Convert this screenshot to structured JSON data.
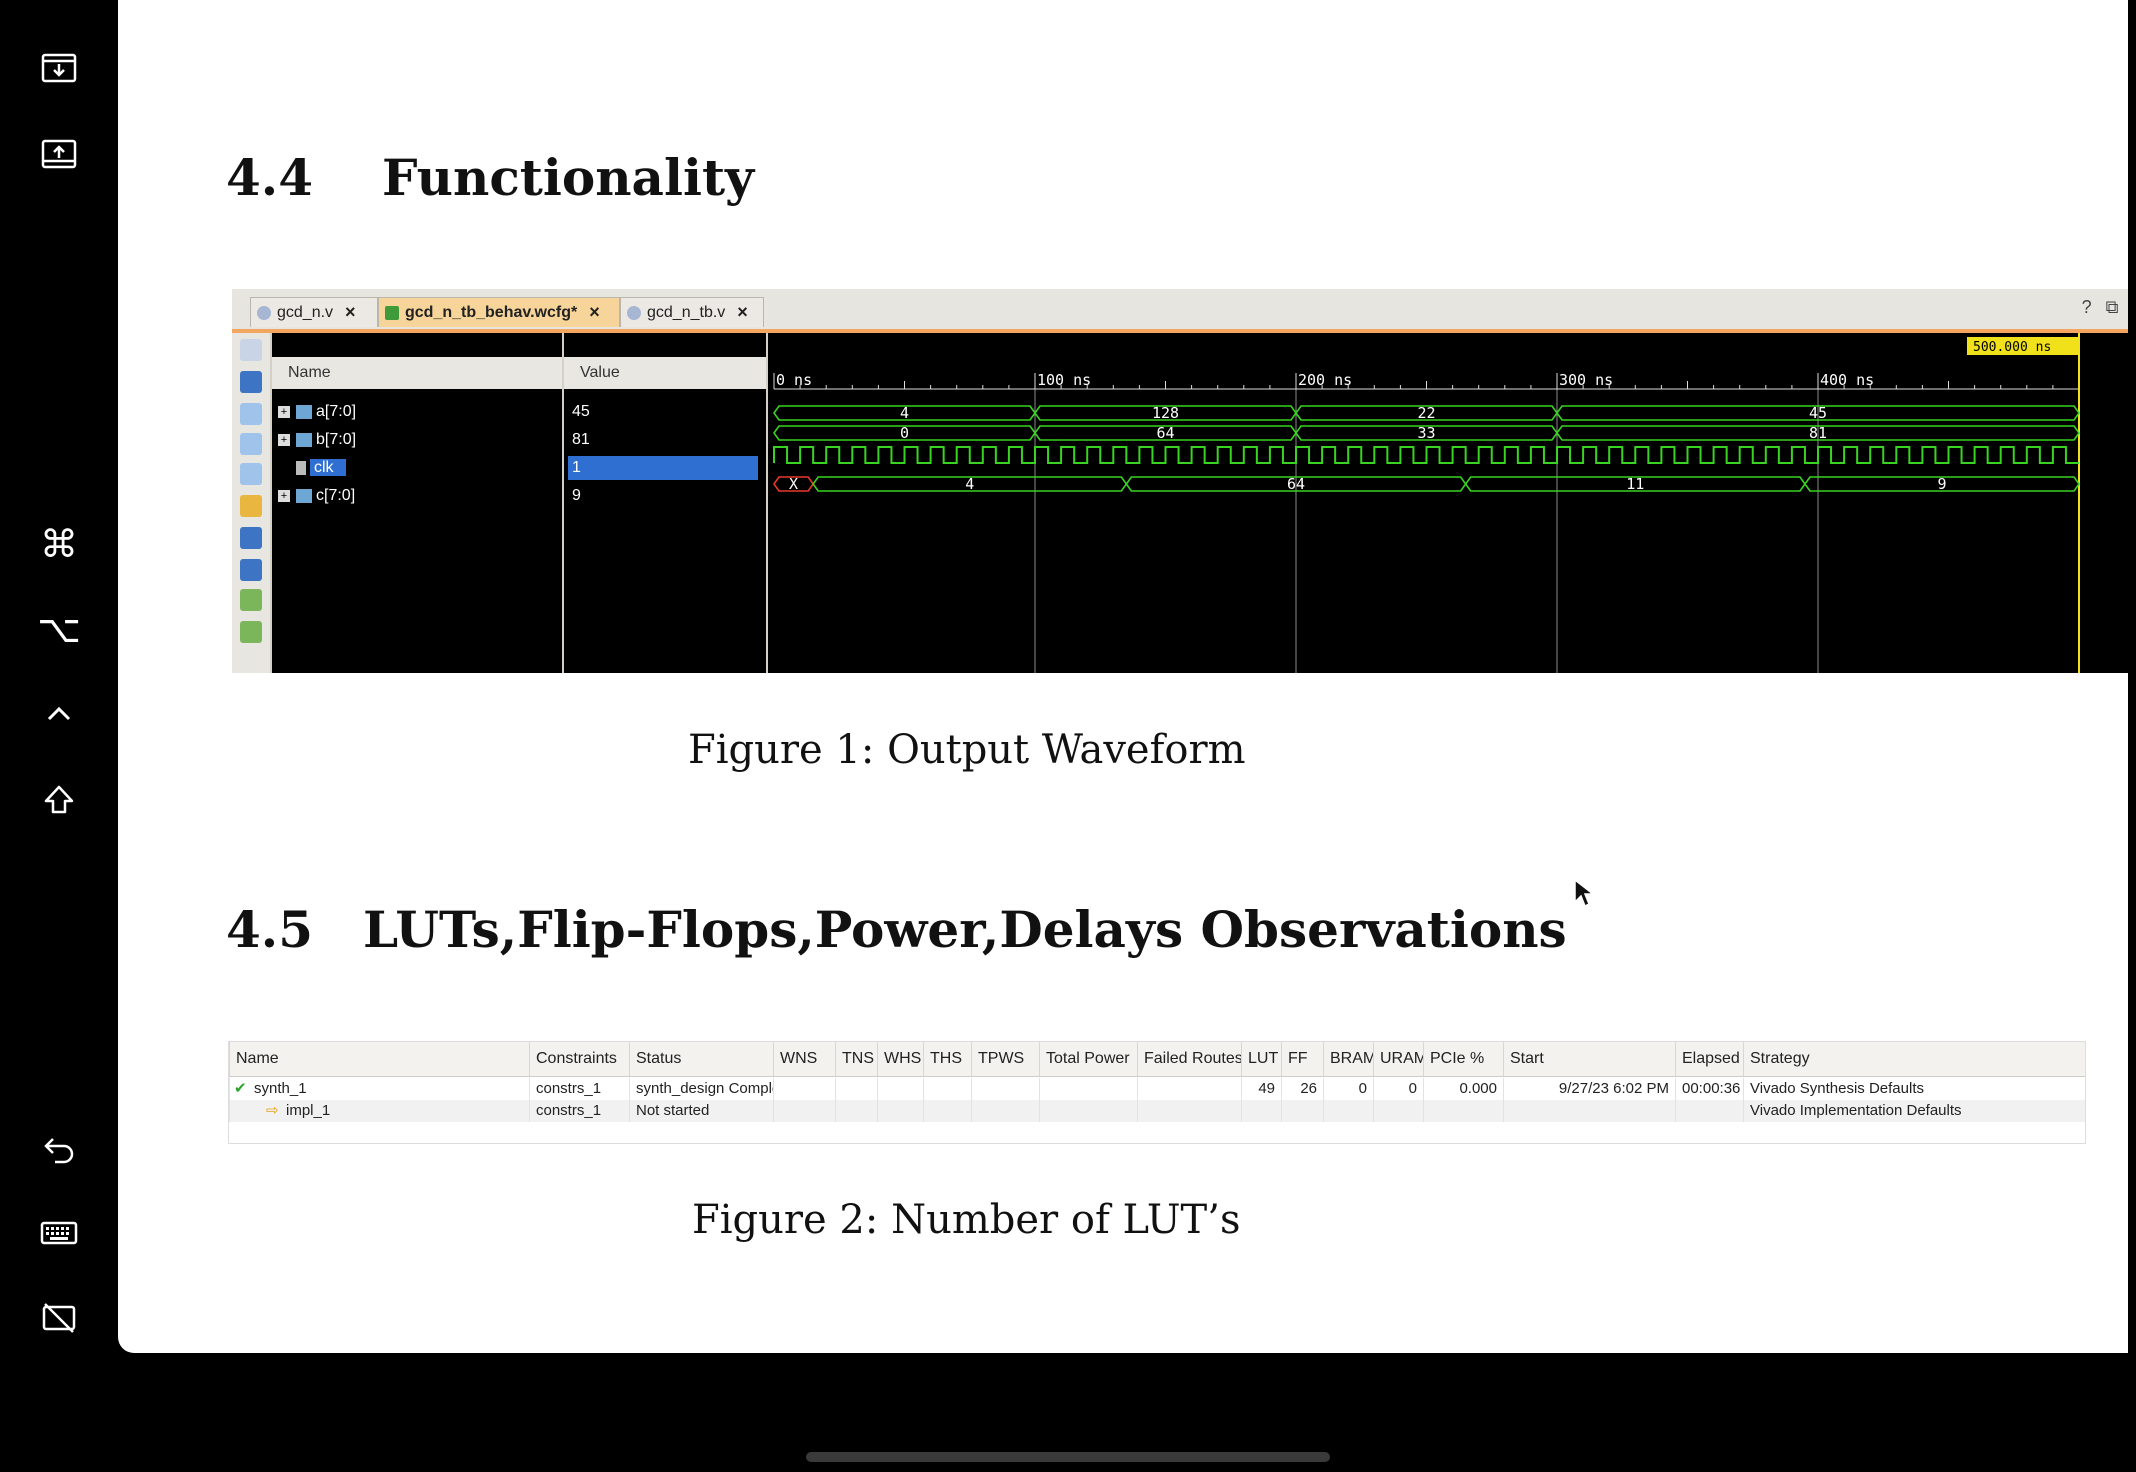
{
  "sections": [
    {
      "number": "4.4",
      "title": "Functionality"
    },
    {
      "number": "4.5",
      "title": "LUTs,Flip-Flops,Power,Delays Observations"
    }
  ],
  "figure1": {
    "caption": "Figure 1: Output Waveform"
  },
  "figure2": {
    "caption": "Figure 2: Number of LUT’s"
  },
  "waveform": {
    "tabs": [
      {
        "label": "gcd_n.v",
        "active": false
      },
      {
        "label": "gcd_n_tb_behav.wcfg*",
        "active": true
      },
      {
        "label": "gcd_n_tb.v",
        "active": false
      }
    ],
    "window_buttons": [
      "?",
      "⧉",
      "⤢",
      "✕"
    ],
    "columns": {
      "name": "Name",
      "value": "Value"
    },
    "signals": [
      {
        "name": "a[7:0]",
        "value": "45",
        "expandable": true
      },
      {
        "name": "b[7:0]",
        "value": "81",
        "expandable": true
      },
      {
        "name": "clk",
        "value": "1",
        "expandable": false
      },
      {
        "name": "c[7:0]",
        "value": "9",
        "expandable": true
      }
    ],
    "cursor_time": "500.000 ns",
    "ruler": [
      "0 ns",
      "100 ns",
      "200 ns",
      "300 ns",
      "400 ns"
    ],
    "buses": [
      {
        "signal": "a[7:0]",
        "segments": [
          {
            "from": 0,
            "to": 100,
            "label": "4"
          },
          {
            "from": 100,
            "to": 200,
            "label": "128"
          },
          {
            "from": 200,
            "to": 300,
            "label": "22"
          },
          {
            "from": 300,
            "to": 500,
            "label": "45"
          }
        ]
      },
      {
        "signal": "b[7:0]",
        "segments": [
          {
            "from": 0,
            "to": 100,
            "label": "0"
          },
          {
            "from": 100,
            "to": 200,
            "label": "64"
          },
          {
            "from": 200,
            "to": 300,
            "label": "33"
          },
          {
            "from": 300,
            "to": 500,
            "label": "81"
          }
        ]
      },
      {
        "signal": "c[7:0]",
        "segments": [
          {
            "from": 0,
            "to": 15,
            "label": "X"
          },
          {
            "from": 15,
            "to": 135,
            "label": "4"
          },
          {
            "from": 135,
            "to": 265,
            "label": "64"
          },
          {
            "from": 265,
            "to": 395,
            "label": "11"
          },
          {
            "from": 395,
            "to": 500,
            "label": "9"
          }
        ]
      }
    ],
    "clock_period_ns": 10,
    "colors": {
      "wave": "#39d321",
      "unknown": "#e8392c",
      "cursor": "#f0e11a"
    }
  },
  "runs_table": {
    "columns": [
      "Name",
      "Constraints",
      "Status",
      "WNS",
      "TNS",
      "WHS",
      "THS",
      "TPWS",
      "Total Power",
      "Failed Routes",
      "LUT",
      "FF",
      "BRAM",
      "URAM",
      "PCIe %",
      "Start",
      "Elapsed",
      "Strategy"
    ],
    "rows": [
      {
        "name": "synth_1",
        "constraints": "constrs_1",
        "status": "synth_design Complete!",
        "lut": "49",
        "ff": "26",
        "bram": "0",
        "uram": "0",
        "pcie": "0.000",
        "start": "9/27/23 6:02 PM",
        "elapsed": "00:00:36",
        "strategy": "Vivado Synthesis Defaults"
      },
      {
        "name": "impl_1",
        "constraints": "constrs_1",
        "status": "Not started",
        "lut": "",
        "ff": "",
        "bram": "",
        "uram": "",
        "pcie": "",
        "start": "",
        "elapsed": "",
        "strategy": "Vivado Implementation Defaults"
      }
    ]
  },
  "toolbar_icons": [
    "download-tray-icon",
    "upload-tray-icon",
    "command-icon",
    "option-icon",
    "control-icon",
    "shift-icon",
    "undo-icon",
    "keyboard-icon",
    "hide-keyboard-icon"
  ]
}
